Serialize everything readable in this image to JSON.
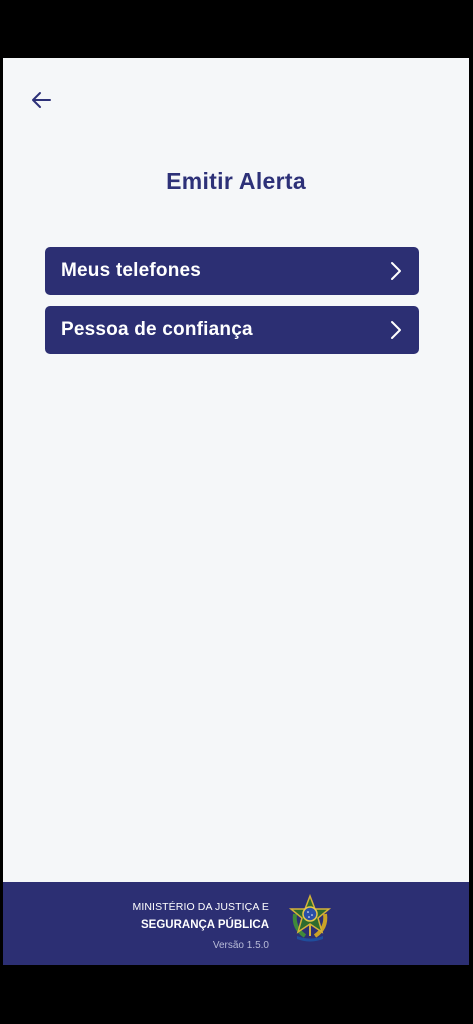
{
  "header": {
    "back_icon": "arrow-left-icon",
    "title": "Emitir Alerta"
  },
  "menu": {
    "items": [
      {
        "label": "Meus telefones",
        "icon": "chevron-right-icon"
      },
      {
        "label": "Pessoa de confiança",
        "icon": "chevron-right-icon"
      }
    ]
  },
  "footer": {
    "ministry_line1": "MINISTÉRIO DA JUSTIÇA E",
    "ministry_line2": "SEGURANÇA PÚBLICA",
    "version": "Versão 1.5.0",
    "emblem_icon": "brazil-coat-of-arms-icon"
  },
  "colors": {
    "primary": "#2c2f73",
    "background": "#f5f7f9",
    "title": "#2d3178"
  }
}
